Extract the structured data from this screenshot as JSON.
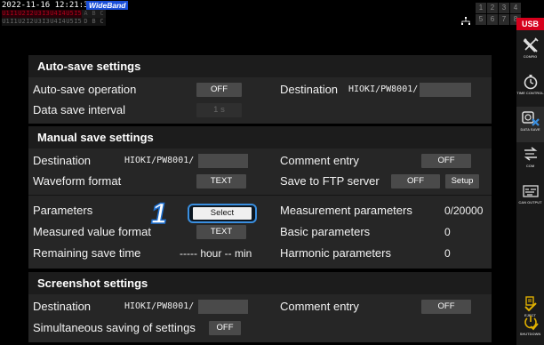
{
  "status_bar": {
    "datetime": "2022-11-16 12:21:30",
    "mode_badge": "WideBand",
    "channel_row_1": [
      "U1",
      "I1",
      "U2",
      "I2",
      "U3",
      "I3",
      "U4",
      "I4",
      "U5",
      "I5",
      "A",
      "B",
      "C"
    ],
    "channel_row_2": [
      "U1",
      "I1",
      "U2",
      "I2",
      "U3",
      "I3",
      "U4",
      "I4",
      "U5",
      "I5",
      "D",
      "B",
      "C"
    ],
    "channel_grid": [
      "1",
      "2",
      "3",
      "4",
      "5",
      "6",
      "7",
      "8"
    ],
    "storage_badge": "USB",
    "accent_color": "#d6001c",
    "highlight_color": "#3a8fe0"
  },
  "sidebar": {
    "items": [
      {
        "label": "CONFIG",
        "icon": "wrench-screwdriver-icon"
      },
      {
        "label": "TIME CONTROL",
        "icon": "stopwatch-icon"
      },
      {
        "label": "DATA SAVE",
        "icon": "data-save-icon"
      },
      {
        "label": "COM",
        "icon": "communication-icon"
      },
      {
        "label": "CAN OUTPUT",
        "icon": "can-output-icon"
      },
      {
        "label": "EJECT",
        "icon": "eject-icon"
      },
      {
        "label": "SHUTDOWN",
        "icon": "shutdown-icon"
      }
    ]
  },
  "autosave": {
    "title": "Auto-save settings",
    "operation_label": "Auto-save operation",
    "operation_value": "OFF",
    "interval_label": "Data save interval",
    "interval_value": "1 s",
    "destination_label": "Destination",
    "destination_path": "HIOKI/PW8001/"
  },
  "manual": {
    "title": "Manual save settings",
    "destination_label": "Destination",
    "destination_path": "HIOKI/PW8001/",
    "comment_label": "Comment entry",
    "comment_value": "OFF",
    "waveform_label": "Waveform format",
    "waveform_value": "TEXT",
    "ftp_label": "Save to FTP server",
    "ftp_value": "OFF",
    "ftp_setup": "Setup",
    "parameters_label": "Parameters",
    "parameters_button": "Select",
    "step_number": "1",
    "measured_format_label": "Measured value format",
    "measured_format_value": "TEXT",
    "remaining_label": "Remaining save time",
    "remaining_value": "----- hour -- min",
    "meas_params_label": "Measurement parameters",
    "meas_params_value": "0/20000",
    "basic_params_label": "Basic parameters",
    "basic_params_value": "0",
    "harmonic_params_label": "Harmonic parameters",
    "harmonic_params_value": "0"
  },
  "screenshot": {
    "title": "Screenshot settings",
    "destination_label": "Destination",
    "destination_path": "HIOKI/PW8001/",
    "comment_label": "Comment entry",
    "comment_value": "OFF",
    "simultaneous_label": "Simultaneous saving of settings",
    "simultaneous_value": "OFF"
  }
}
